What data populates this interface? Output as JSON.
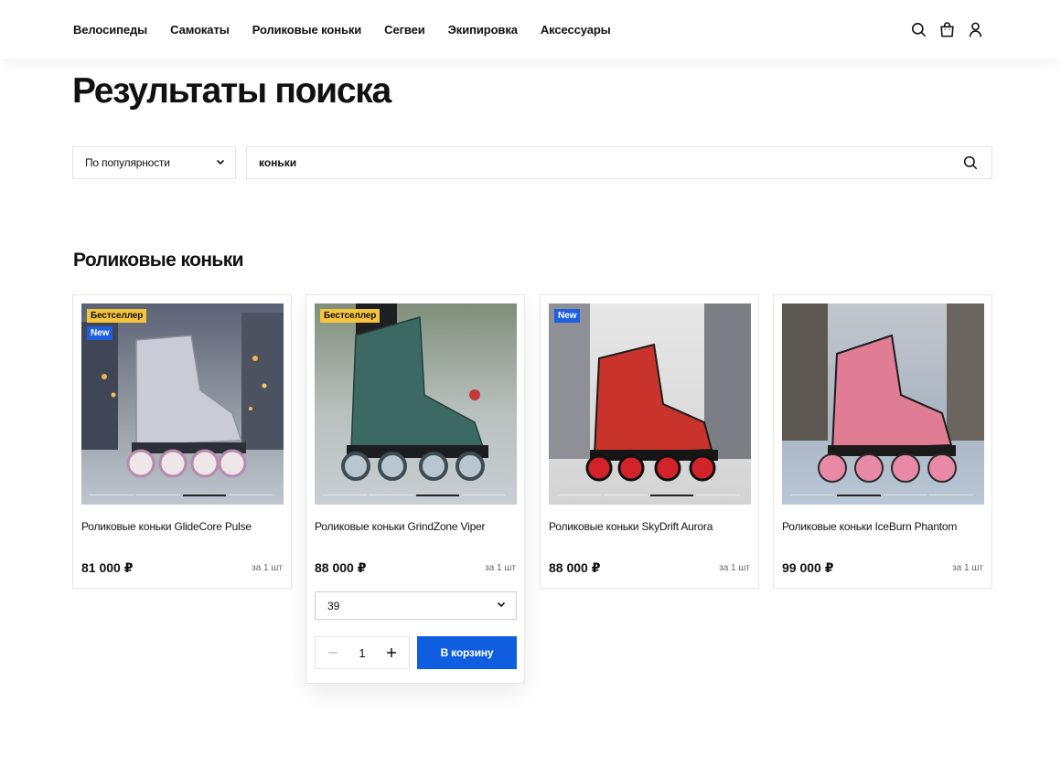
{
  "nav": {
    "items": [
      "Велосипеды",
      "Самокаты",
      "Роликовые коньки",
      "Сегвеи",
      "Экипировка",
      "Аксессуары"
    ]
  },
  "header_icons": [
    "search-icon",
    "bag-icon",
    "user-icon"
  ],
  "page": {
    "title": "Результаты поиска"
  },
  "filters": {
    "sort_label": "По популярности",
    "search_value": "коньки"
  },
  "section": {
    "title": "Роликовые коньки"
  },
  "products": [
    {
      "name": "Роликовые коньки GlideCore Pulse",
      "price": "81 000 ₽",
      "unit": "за 1 шт",
      "badges": [
        "Бестселлер",
        "New"
      ],
      "skate_color": "#c9ccd6"
    },
    {
      "name": "Роликовые коньки GrindZone Viper",
      "price": "88 000 ₽",
      "unit": "за 1 шт",
      "badges": [
        "Бестселлер"
      ],
      "skate_color": "#3c6a63"
    },
    {
      "name": "Роликовые коньки SkyDrift Aurora",
      "price": "88 000 ₽",
      "unit": "за 1 шт",
      "badges": [
        "New"
      ],
      "skate_color": "#c8332b"
    },
    {
      "name": "Роликовые коньки IceBurn Phantom",
      "price": "99 000 ₽",
      "unit": "за 1 шт",
      "badges": [],
      "skate_color": "#e07d95"
    }
  ],
  "active_card": {
    "size_value": "39",
    "quantity": "1",
    "cart_label": "В корзину"
  },
  "colors": {
    "accent": "#0f5ee0",
    "badge_bestseller": "#f6c43c",
    "badge_new": "#1d5fe0"
  }
}
